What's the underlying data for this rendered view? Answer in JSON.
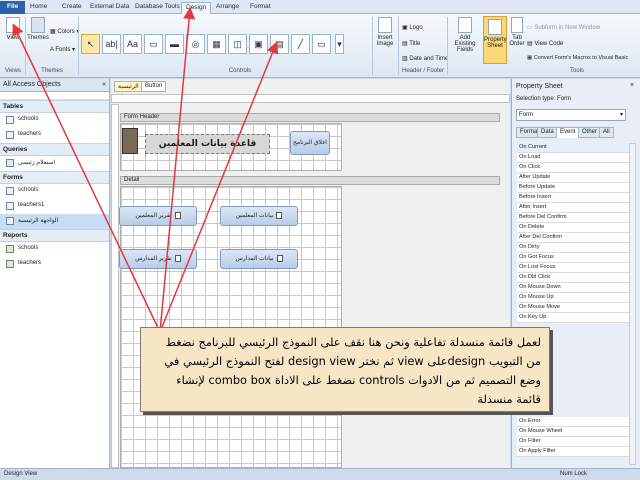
{
  "ribbon": {
    "tabs": [
      {
        "label": "File"
      },
      {
        "label": "Home"
      },
      {
        "label": "Create"
      },
      {
        "label": "External Data"
      },
      {
        "label": "Database Tools"
      },
      {
        "label": "Design"
      },
      {
        "label": "Arrange"
      },
      {
        "label": "Format"
      }
    ],
    "view_label": "View",
    "themes_label": "Themes",
    "colors_label": "Colors",
    "fonts_label": "Fonts",
    "group_views": "Views",
    "group_themes": "Themes",
    "group_controls": "Controls",
    "group_header_footer": "Header / Footer",
    "group_tools": "Tools",
    "insert_image_label": "Insert Image",
    "logo_label": "Logo",
    "title_label": "Title",
    "date_time_label": "Date and Time",
    "add_fields_label": "Add Existing Fields",
    "property_sheet_label": "Property Sheet",
    "tab_order_label": "Tab Order",
    "subform_label": "Subform in New Window",
    "view_code_label": "View Code",
    "convert_macros_label": "Convert Form's Macros to Visual Basic",
    "control_glyphs": [
      "↖",
      "ab|",
      "Aa",
      "▭",
      "▬",
      "◎",
      "▦",
      "◫",
      "▣",
      "▤",
      "╱",
      "▭"
    ]
  },
  "nav": {
    "header": "All Access Objects",
    "sections": [
      {
        "title": "Tables",
        "items": [
          "schools",
          "teachers"
        ]
      },
      {
        "title": "Queries",
        "items": [
          "استعلام رئيسي"
        ]
      },
      {
        "title": "Forms",
        "items": [
          "schools",
          "teachers1",
          "الواجهة الرئيسية"
        ]
      },
      {
        "title": "Reports",
        "items": [
          "schools",
          "teachers"
        ]
      }
    ],
    "selected_item": "الواجهة الرئيسية"
  },
  "document": {
    "tabs": [
      "واجهة الرئيسية",
      "Button"
    ],
    "form_header_label": "Form Header",
    "detail_label": "Detail",
    "title_text": "قاعدة بيانات المعلمين",
    "close_button": "اغلاق البرنامج",
    "buttons": [
      "تقرير المعلمين",
      "بيانات المعلمين",
      "تقرير المدارس",
      "بيانات المدارس"
    ]
  },
  "property_sheet": {
    "title": "Property Sheet",
    "selection_type": "Selection type:  Form",
    "selector_value": "Form",
    "tabs": [
      "Format",
      "Data",
      "Event",
      "Other",
      "All"
    ],
    "active_tab": "Event",
    "events": [
      "On Current",
      "On Load",
      "On Click",
      "After Update",
      "Before Update",
      "Before Insert",
      "After Insert",
      "Before Del Confirm",
      "On Delete",
      "After Del Confirm",
      "On Dirty",
      "On Got Focus",
      "On Lost Focus",
      "On Dbl Click",
      "On Mouse Down",
      "On Mouse Up",
      "On Mouse Move",
      "On Key Up"
    ],
    "events_bottom": [
      "On Error",
      "On Mouse Wheel",
      "On Filter",
      "On Apply Filter"
    ]
  },
  "status": {
    "left": "Design View",
    "right": "Num Lock"
  },
  "callout": {
    "text": "لعمل قائمة منسدلة تفاعلية ونحن هنا نقف على النموذج الرئيسي للبرنامج نضغط من التبويب designعلى view ثم نختر design view لفتح النموذج الرئيسي في وضع التصميم ثم من الادوات controls نضغط على الاداة combo box لإنشاء قائمة منسدلة"
  },
  "colors": {
    "callout_bg": "#f7e6c5",
    "arrow": "#e0393e",
    "file_tab": "#2c62ad"
  }
}
